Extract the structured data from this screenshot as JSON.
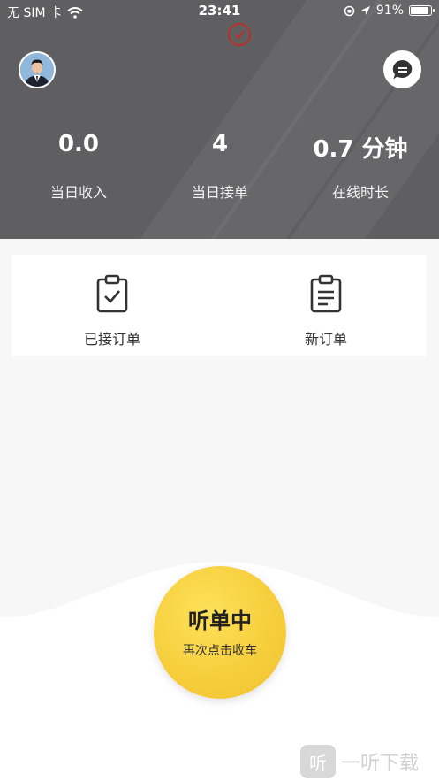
{
  "status_bar": {
    "carrier": "无 SIM 卡",
    "time": "23:41",
    "battery": "91%"
  },
  "stats": [
    {
      "value": "0.0",
      "label": "当日收入"
    },
    {
      "value": "4",
      "label": "当日接单"
    },
    {
      "value": "0.7 分钟",
      "label": "在线时长"
    }
  ],
  "orders": {
    "accepted_label": "已接订单",
    "new_label": "新订单"
  },
  "listen_button": {
    "title": "听单中",
    "subtitle": "再次点击收车"
  },
  "watermark": {
    "glyph": "听",
    "text": "一听下载"
  },
  "colors": {
    "header_bg": "#5f5f61",
    "accent_yellow": "#f6cd3a"
  }
}
